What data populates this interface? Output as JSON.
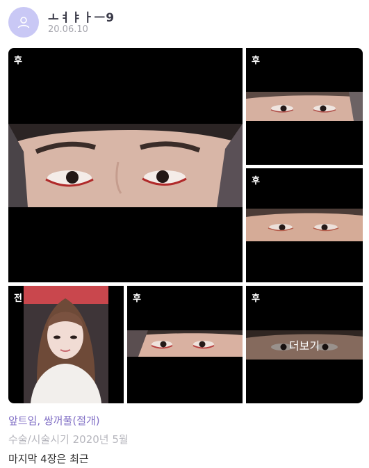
{
  "post": {
    "username": "ㅗㅕㅑㅏㅡ9",
    "date": "20.06.10"
  },
  "gallery": {
    "tiles": [
      {
        "tag": "후"
      },
      {
        "tag": "후"
      },
      {
        "tag": "후"
      },
      {
        "tag": "전"
      },
      {
        "tag": "후"
      },
      {
        "tag": "후",
        "overlay": "더보기"
      }
    ]
  },
  "details": {
    "procedure": "앞트임, 쌍꺼풀(절개)",
    "period": "수술/시술시기 2020년 5월",
    "note": "마지막 4장은 최근"
  }
}
